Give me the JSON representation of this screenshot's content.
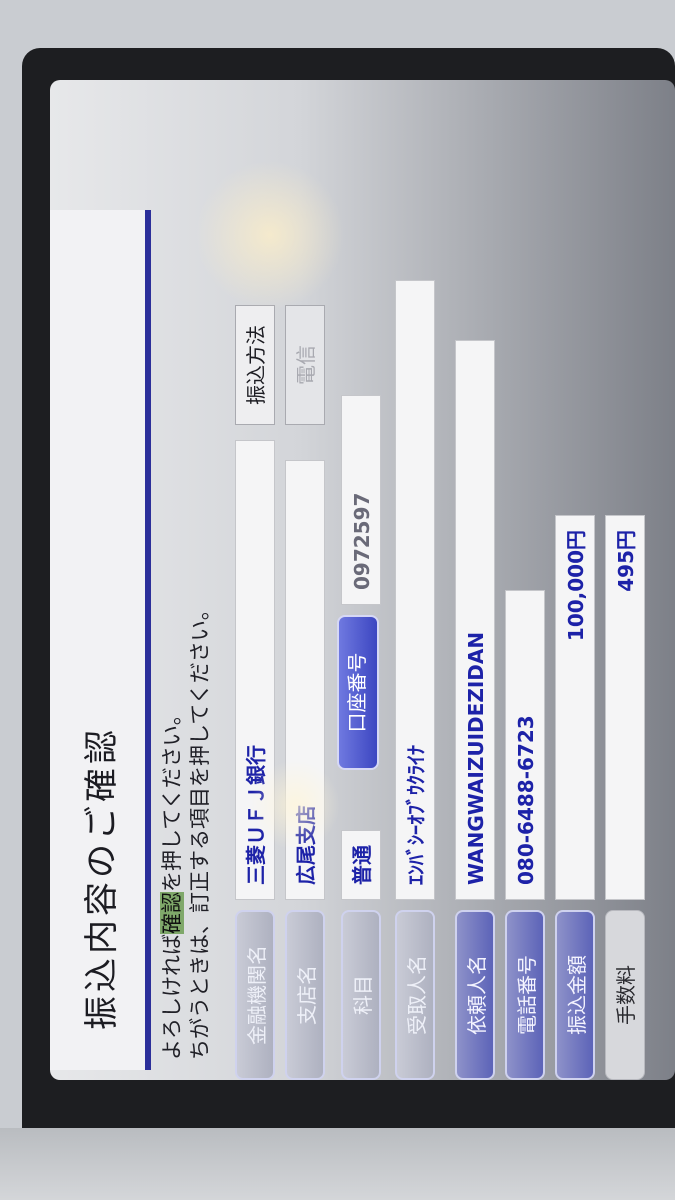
{
  "screen": {
    "title": "振込内容のご確認",
    "instruction_line1_pre": "よろしければ",
    "instruction_line1_highlight": "確認",
    "instruction_line1_post": "を押してください。",
    "instruction_line2": "ちがうときは、訂正する項目を押してください。"
  },
  "fields": {
    "bank": {
      "label": "金融機関名",
      "value": "三菱ＵＦＪ銀行"
    },
    "branch": {
      "label": "支店名",
      "value": "広尾支店"
    },
    "account_type": {
      "label": "科目",
      "value": "普通"
    },
    "account_number": {
      "label": "口座番号",
      "value": "0972597"
    },
    "recipient": {
      "label": "受取人名",
      "value": "ｴﾝﾊﾞｼｰｵﾌﾞｳｸﾗｲﾅ"
    },
    "phone": {
      "label": "電話番号",
      "value": "080-6488-6723"
    },
    "sender": {
      "label": "依頼人名",
      "value": "WANGWAIZUIDEZIDAN"
    },
    "amount": {
      "label": "振込金額",
      "value": "100,000円"
    },
    "fee": {
      "label": "手数料",
      "value": "495円"
    }
  },
  "buttons": {
    "transfer_method": "振込方法",
    "telegraphic": "電信"
  }
}
